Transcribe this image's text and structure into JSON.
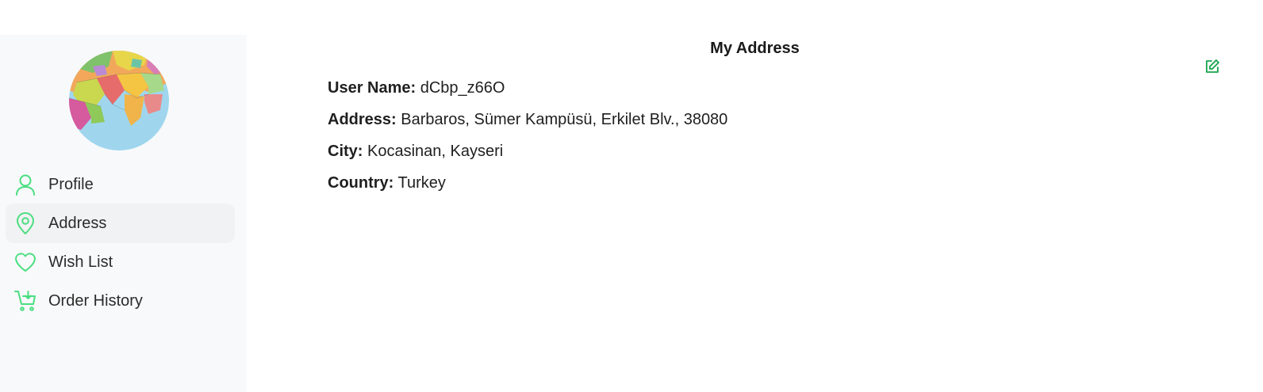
{
  "sidebar": {
    "avatar_icon": "world-map-globe",
    "items": [
      {
        "label": "Profile",
        "icon": "user-icon",
        "active": false
      },
      {
        "label": "Address",
        "icon": "map-pin-icon",
        "active": true
      },
      {
        "label": "Wish List",
        "icon": "heart-icon",
        "active": false
      },
      {
        "label": "Order History",
        "icon": "cart-icon",
        "active": false
      }
    ]
  },
  "main": {
    "title": "My Address",
    "edit_icon": "edit-icon",
    "fields": [
      {
        "label": "User Name:",
        "value": "dCbp_z66O"
      },
      {
        "label": "Address:",
        "value": "Barbaros, Sümer Kampüsü, Erkilet Blv., 38080"
      },
      {
        "label": "City:",
        "value": "Kocasinan, Kayseri"
      },
      {
        "label": "Country:",
        "value": "Turkey"
      }
    ]
  },
  "colors": {
    "accent": "#4ade80",
    "sidebar_bg": "#f8f9fb",
    "active_item_bg": "#f1f2f4",
    "edit_icon": "#16a34a"
  }
}
